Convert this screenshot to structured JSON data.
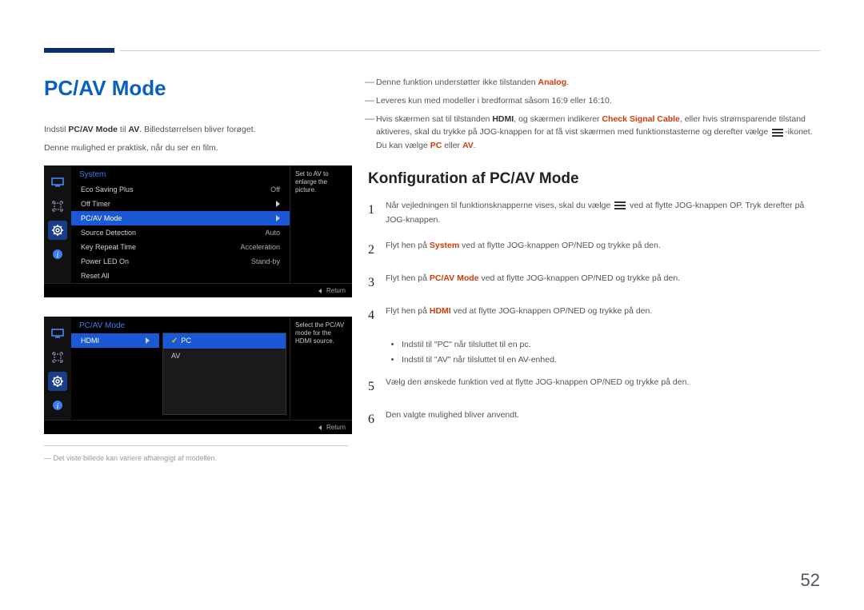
{
  "page_number": "52",
  "left": {
    "title": "PC/AV Mode",
    "intro_line1_pre": "Indstil ",
    "intro_line1_b1": "PC/AV Mode",
    "intro_line1_mid": " til ",
    "intro_line1_b2": "AV",
    "intro_line1_post": ". Billedstørrelsen bliver forøget.",
    "intro_line2": "Denne mulighed er praktisk, når du ser en film.",
    "osd1": {
      "title": "System",
      "hint": "Set to AV to enlarge the picture.",
      "rows": [
        {
          "label": "Eco Saving Plus",
          "value": "Off"
        },
        {
          "label": "Off Timer",
          "value": "▶"
        },
        {
          "label": "PC/AV Mode",
          "value": "▶",
          "selected": true
        },
        {
          "label": "Source Detection",
          "value": "Auto"
        },
        {
          "label": "Key Repeat Time",
          "value": "Acceleration"
        },
        {
          "label": "Power LED On",
          "value": "Stand-by"
        },
        {
          "label": "Reset All",
          "value": ""
        }
      ],
      "return": "Return"
    },
    "osd2": {
      "title": "PC/AV Mode",
      "hint": "Select the PC/AV mode for the HDMI source.",
      "col1_row": "HDMI",
      "opts": [
        {
          "label": "PC",
          "selected": true
        },
        {
          "label": "AV"
        }
      ],
      "return": "Return"
    },
    "caption": "― Det viste billede kan variere afhængigt af modellen."
  },
  "right": {
    "note1_pre": "Denne funktion understøtter ikke tilstanden ",
    "note1_analog": "Analog",
    "note1_post": ".",
    "note2": "Leveres kun med modeller i bredformat såsom 16:9 eller 16:10.",
    "note3_a": "Hvis skærmen sat til tilstanden ",
    "note3_hdmi": "HDMI",
    "note3_b": ", og skærmen indikerer ",
    "note3_check": "Check Signal Cable",
    "note3_c": ", eller hvis strømsparende tilstand aktiveres, skal du trykke på JOG-knappen for at få vist skærmen med funktionstasterne og derefter vælge ",
    "note3_d": "-ikonet. Du kan vælge ",
    "note3_pcav": "PC",
    "note3_or": " eller ",
    "note3_av": "AV",
    "note3_e": ".",
    "subhead": "Konfiguration af PC/AV Mode",
    "steps": {
      "s1a": "Når vejledningen til funktionsknapperne vises, skal du vælge ",
      "s1b": " ved at flytte JOG-knappen OP. Tryk derefter på JOG-knappen.",
      "s2a": "Flyt hen på ",
      "s2sys": "System",
      "s2b": " ved at flytte JOG-knappen OP/NED og trykke på den.",
      "s3a": "Flyt hen på ",
      "s3pc": "PC/AV Mode",
      "s3b": " ved at flytte JOG-knappen OP/NED og trykke på den.",
      "s4a": "Flyt hen på ",
      "s4hdmi": "HDMI",
      "s4b": " ved at flytte JOG-knappen OP/NED og trykke på den.",
      "bullet1": "Indstil til \"PC\" når tilsluttet til en pc.",
      "bullet2": "Indstil til \"AV\" når tilsluttet til en AV-enhed.",
      "s5": "Vælg den ønskede funktion ved at flytte JOG-knappen OP/NED og trykke på den.",
      "s6": "Den valgte mulighed bliver anvendt."
    }
  }
}
